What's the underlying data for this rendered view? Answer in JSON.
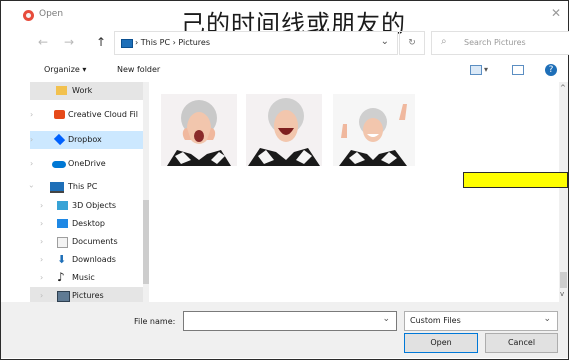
{
  "window": {
    "title": "Open",
    "overlay_text": "己的时间线或朋友的"
  },
  "navigation": {
    "back": "←",
    "forward": "→",
    "up": "↑",
    "address_path": "› This PC › Pictures",
    "search_placeholder": "Search Pictures"
  },
  "toolbar": {
    "organize_label": "Organize ▾",
    "new_folder_label": "New folder"
  },
  "sidebar": {
    "items": [
      {
        "label": "Work",
        "icon": "folder-icon",
        "color": "#f2c14e"
      },
      {
        "label": "Creative Cloud Fil",
        "icon": "creative-cloud-icon",
        "color": "#e64a19"
      },
      {
        "label": "Dropbox",
        "icon": "dropbox-icon",
        "color": "#0061fe"
      },
      {
        "label": "OneDrive",
        "icon": "onedrive-icon",
        "color": "#0078d4"
      },
      {
        "label": "This PC",
        "icon": "this-pc-icon",
        "color": "#1e6fb8"
      },
      {
        "label": "3D Objects",
        "icon": "3d-objects-icon",
        "color": "#38a3d6"
      },
      {
        "label": "Desktop",
        "icon": "desktop-icon",
        "color": "#1e88e5"
      },
      {
        "label": "Documents",
        "icon": "documents-icon",
        "color": "#9e9e9e"
      },
      {
        "label": "Downloads",
        "icon": "downloads-icon",
        "color": "#1e6fb8"
      },
      {
        "label": "Music",
        "icon": "music-icon",
        "color": "#1b1b1b"
      },
      {
        "label": "Pictures",
        "icon": "pictures-icon",
        "color": "#5f7a93"
      }
    ]
  },
  "files": [
    {
      "name": "",
      "icon": "photo-thumbnail-icon"
    },
    {
      "name": "",
      "icon": "photo-thumbnail-icon"
    },
    {
      "name": "",
      "icon": "photo-thumbnail-icon"
    }
  ],
  "footer": {
    "file_name_label": "File name:",
    "file_name_value": "",
    "file_type": "Custom Files",
    "open_label": "Open",
    "cancel_label": "Cancel"
  },
  "colors": {
    "accent": "#0078d7",
    "highlight": "#ffff00"
  }
}
